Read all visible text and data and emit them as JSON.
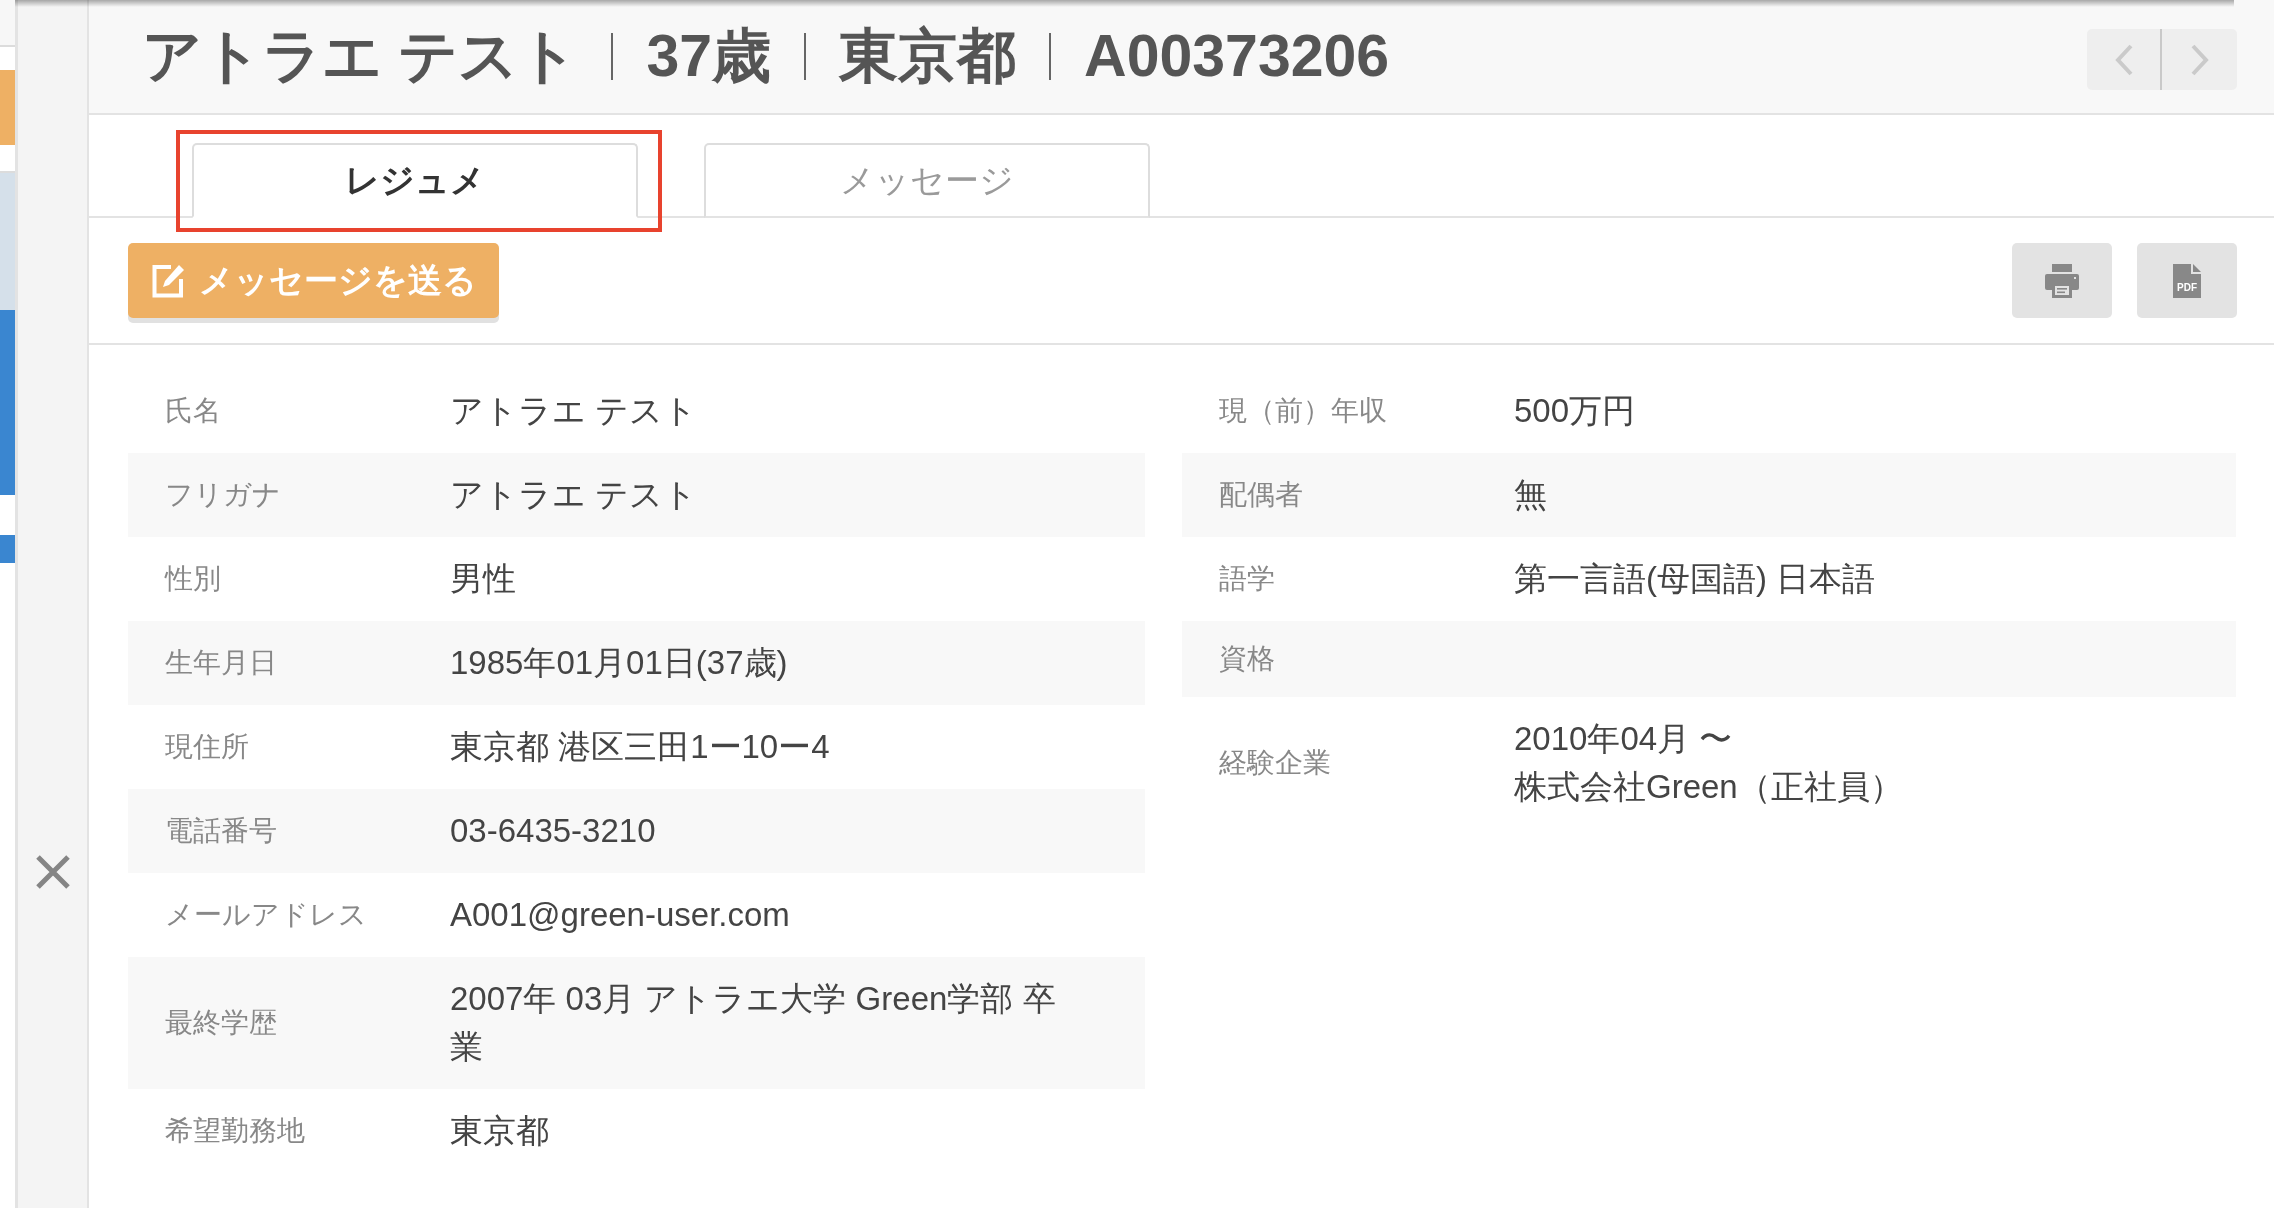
{
  "header": {
    "name": "アトラエ テスト",
    "age": "37歳",
    "location": "東京都",
    "id": "A00373206"
  },
  "tabs": [
    {
      "label": "レジュメ",
      "selected": true,
      "highlighted": true
    },
    {
      "label": "メッセージ",
      "selected": false,
      "highlighted": false
    }
  ],
  "actions": {
    "send_button": "メッセージを送る",
    "pdf_icon_label": "PDF"
  },
  "profile": {
    "left": [
      {
        "label": "氏名",
        "value": "アトラエ テスト"
      },
      {
        "label": "フリガナ",
        "value": "アトラエ テスト"
      },
      {
        "label": "性別",
        "value": "男性"
      },
      {
        "label": "生年月日",
        "value": "1985年01月01日(37歳)"
      },
      {
        "label": "現住所",
        "value": "東京都 港区三田1ー10ー4"
      },
      {
        "label": "電話番号",
        "value": "03-6435-3210"
      },
      {
        "label": "メールアドレス",
        "value": "A001@green-user.com"
      },
      {
        "label": "最終学歴",
        "value": "2007年 03月 アトラエ大学 Green学部 卒業"
      },
      {
        "label": "希望勤務地",
        "value": "東京都"
      }
    ],
    "right": [
      {
        "label": "現（前）年収",
        "value": "500万円"
      },
      {
        "label": "配偶者",
        "value": "無"
      },
      {
        "label": "語学",
        "value": "第一言語(母国語) 日本語"
      },
      {
        "label": "資格"
      },
      {
        "label": "経験企業",
        "value": [
          "2010年04月 〜",
          "株式会社Green（正社員）"
        ]
      }
    ]
  }
}
